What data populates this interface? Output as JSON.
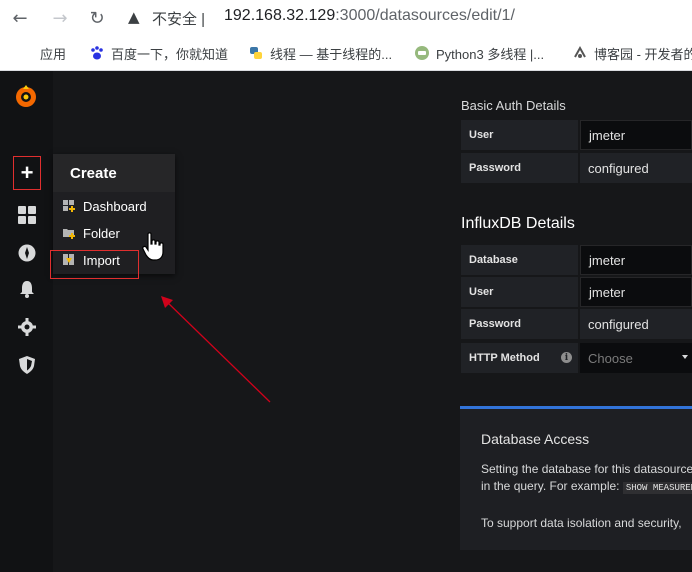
{
  "browser": {
    "security_label": "不安全",
    "url_host": "192.168.32.129",
    "url_rest": ":3000/datasources/edit/1/",
    "bookmarks": [
      {
        "label": "应用"
      },
      {
        "label": "百度一下，你就知道"
      },
      {
        "label": "线程 — 基于线程的..."
      },
      {
        "label": "Python3 多线程 |..."
      },
      {
        "label": "博客园 - 开发者的"
      }
    ]
  },
  "menu": {
    "title": "Create",
    "items": [
      {
        "label": "Dashboard"
      },
      {
        "label": "Folder"
      },
      {
        "label": "Import"
      }
    ]
  },
  "basic_auth": {
    "heading": "Basic Auth Details",
    "user_label": "User",
    "user_value": "jmeter",
    "password_label": "Password",
    "password_value": "configured"
  },
  "influx": {
    "heading": "InfluxDB Details",
    "database_label": "Database",
    "database_value": "jmeter",
    "user_label": "User",
    "user_value": "jmeter",
    "password_label": "Password",
    "password_value": "configured",
    "http_method_label": "HTTP Method",
    "http_method_placeholder": "Choose"
  },
  "access": {
    "title": "Database Access",
    "line1": "Setting the database for this datasource",
    "line2_prefix": "in the query. For example:",
    "line2_code": "SHOW MEASUREMENTS",
    "line3": "To support data isolation and security,"
  },
  "colors": {
    "highlight_red": "#e02f2f",
    "grafana_orange": "#f46800",
    "panel_blue": "#3274d9"
  }
}
